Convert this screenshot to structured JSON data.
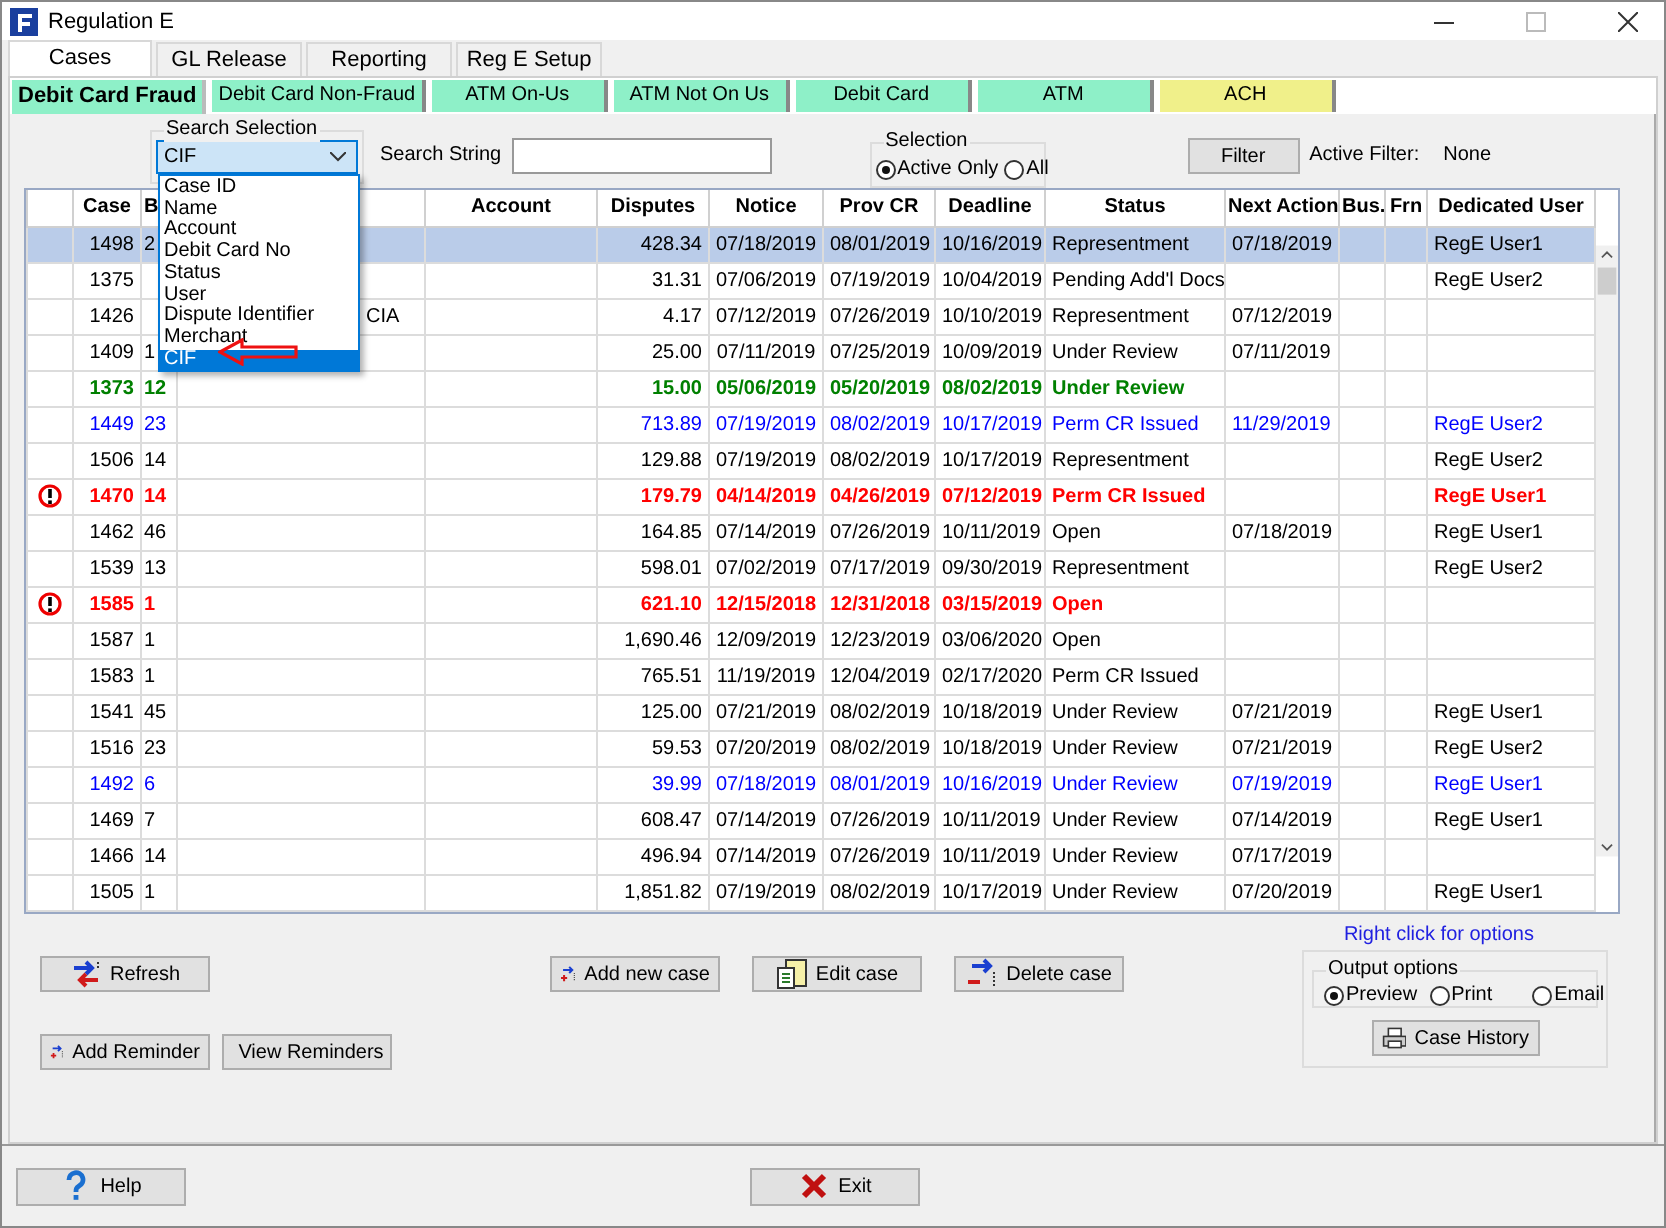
{
  "window": {
    "title": "Regulation E"
  },
  "tabs": [
    {
      "label": "Cases",
      "selected": true
    },
    {
      "label": "GL Release",
      "selected": false
    },
    {
      "label": "Reporting",
      "selected": false
    },
    {
      "label": "Reg E Setup",
      "selected": false
    }
  ],
  "subtabs": [
    {
      "label": "Debit Card Fraud",
      "selected": true,
      "color": "#8ef0c8"
    },
    {
      "label": "Debit Card Non-Fraud",
      "selected": false,
      "color": "#8ef0c8"
    },
    {
      "label": "ATM On-Us",
      "selected": false,
      "color": "#8ef0c8"
    },
    {
      "label": "ATM Not On Us",
      "selected": false,
      "color": "#8ef0c8"
    },
    {
      "label": "Debit Card",
      "selected": false,
      "color": "#8ef0c8"
    },
    {
      "label": "ATM",
      "selected": false,
      "color": "#8ef0c8"
    },
    {
      "label": "ACH",
      "selected": false,
      "color": "#f0f08a"
    }
  ],
  "search": {
    "group_label": "Search Selection",
    "value": "CIF",
    "expanded": true,
    "options": [
      {
        "label": "Case ID",
        "selected": false
      },
      {
        "label": "Name",
        "selected": false
      },
      {
        "label": "Account",
        "selected": false
      },
      {
        "label": "Debit Card No",
        "selected": false
      },
      {
        "label": "Status",
        "selected": false
      },
      {
        "label": "User",
        "selected": false
      },
      {
        "label": "Dispute Identifier",
        "selected": false
      },
      {
        "label": "Merchant",
        "selected": false
      },
      {
        "label": "CIF",
        "selected": true
      }
    ],
    "string_label": "Search String"
  },
  "selection": {
    "label": "Selection",
    "options": [
      {
        "label": "Active Only",
        "selected": true
      },
      {
        "label": "All",
        "selected": false
      }
    ]
  },
  "filter": {
    "button": "Filter",
    "active_label": "Active Filter:",
    "active_value": "None"
  },
  "table": {
    "columns": [
      "Case",
      "B",
      "Account",
      "Disputes",
      "Notice",
      "Prov CR",
      "Deadline",
      "Status",
      "Next Action",
      "Bus.",
      "Frn",
      "Dedicated User"
    ],
    "rows": [
      {
        "selected": true,
        "color": "#000000",
        "bold": false,
        "alert": false,
        "case": "1498",
        "b": "2",
        "disputes": "428.34",
        "notice": "07/18/2019",
        "prov_cr": "08/01/2019",
        "deadline": "10/16/2019",
        "status": "Representment",
        "next_action": "07/18/2019",
        "dedicated_user": "RegE User1"
      },
      {
        "selected": false,
        "color": "#000000",
        "bold": false,
        "alert": false,
        "case": "1375",
        "disputes": "31.31",
        "notice": "07/06/2019",
        "prov_cr": "07/19/2019",
        "deadline": "10/04/2019",
        "status": "Pending Add'l Docs",
        "dedicated_user": "RegE User2"
      },
      {
        "selected": false,
        "color": "#000000",
        "bold": false,
        "alert": false,
        "case": "1426",
        "column_3": "CIA",
        "disputes": "4.17",
        "notice": "07/12/2019",
        "prov_cr": "07/26/2019",
        "deadline": "10/10/2019",
        "status": "Representment",
        "next_action": "07/12/2019"
      },
      {
        "selected": false,
        "color": "#000000",
        "bold": false,
        "alert": false,
        "case": "1409",
        "b": "1",
        "disputes": "25.00",
        "notice": "07/11/2019",
        "prov_cr": "07/25/2019",
        "deadline": "10/09/2019",
        "status": "Under Review",
        "next_action": "07/11/2019"
      },
      {
        "selected": false,
        "color": "#008000",
        "bold": true,
        "alert": false,
        "case": "1373",
        "b": "12",
        "disputes": "15.00",
        "notice": "05/06/2019",
        "prov_cr": "05/20/2019",
        "deadline": "08/02/2019",
        "status": "Under Review"
      },
      {
        "selected": false,
        "color": "#0000ff",
        "bold": false,
        "alert": false,
        "case": "1449",
        "b": "23",
        "disputes": "713.89",
        "notice": "07/19/2019",
        "prov_cr": "08/02/2019",
        "deadline": "10/17/2019",
        "status": "Perm CR Issued",
        "next_action": "11/29/2019",
        "dedicated_user": "RegE User2"
      },
      {
        "selected": false,
        "color": "#000000",
        "bold": false,
        "alert": false,
        "case": "1506",
        "b": "14",
        "disputes": "129.88",
        "notice": "07/19/2019",
        "prov_cr": "08/02/2019",
        "deadline": "10/17/2019",
        "status": "Representment",
        "dedicated_user": "RegE User2"
      },
      {
        "selected": false,
        "color": "#ff0000",
        "bold": true,
        "alert": true,
        "case": "1470",
        "b": "14",
        "disputes": "179.79",
        "notice": "04/14/2019",
        "prov_cr": "04/26/2019",
        "deadline": "07/12/2019",
        "status": "Perm CR Issued",
        "dedicated_user": "RegE User1"
      },
      {
        "selected": false,
        "color": "#000000",
        "bold": false,
        "alert": false,
        "case": "1462",
        "b": "46",
        "disputes": "164.85",
        "notice": "07/14/2019",
        "prov_cr": "07/26/2019",
        "deadline": "10/11/2019",
        "status": "Open",
        "next_action": "07/18/2019",
        "dedicated_user": "RegE User1"
      },
      {
        "selected": false,
        "color": "#000000",
        "bold": false,
        "alert": false,
        "case": "1539",
        "b": "13",
        "disputes": "598.01",
        "notice": "07/02/2019",
        "prov_cr": "07/17/2019",
        "deadline": "09/30/2019",
        "status": "Representment",
        "dedicated_user": "RegE User2"
      },
      {
        "selected": false,
        "color": "#ff0000",
        "bold": true,
        "alert": true,
        "case": "1585",
        "b": "1",
        "disputes": "621.10",
        "notice": "12/15/2018",
        "prov_cr": "12/31/2018",
        "deadline": "03/15/2019",
        "status": "Open"
      },
      {
        "selected": false,
        "color": "#000000",
        "bold": false,
        "alert": false,
        "case": "1587",
        "b": "1",
        "disputes": "1,690.46",
        "notice": "12/09/2019",
        "prov_cr": "12/23/2019",
        "deadline": "03/06/2020",
        "status": "Open"
      },
      {
        "selected": false,
        "color": "#000000",
        "bold": false,
        "alert": false,
        "case": "1583",
        "b": "1",
        "disputes": "765.51",
        "notice": "11/19/2019",
        "prov_cr": "12/04/2019",
        "deadline": "02/17/2020",
        "status": "Perm CR Issued"
      },
      {
        "selected": false,
        "color": "#000000",
        "bold": false,
        "alert": false,
        "case": "1541",
        "b": "45",
        "disputes": "125.00",
        "notice": "07/21/2019",
        "prov_cr": "08/02/2019",
        "deadline": "10/18/2019",
        "status": "Under Review",
        "next_action": "07/21/2019",
        "dedicated_user": "RegE User1"
      },
      {
        "selected": false,
        "color": "#000000",
        "bold": false,
        "alert": false,
        "case": "1516",
        "b": "23",
        "disputes": "59.53",
        "notice": "07/20/2019",
        "prov_cr": "08/02/2019",
        "deadline": "10/18/2019",
        "status": "Under Review",
        "next_action": "07/21/2019",
        "dedicated_user": "RegE User2"
      },
      {
        "selected": false,
        "color": "#0000ff",
        "bold": false,
        "alert": false,
        "case": "1492",
        "b": "6",
        "disputes": "39.99",
        "notice": "07/18/2019",
        "prov_cr": "08/01/2019",
        "deadline": "10/16/2019",
        "status": "Under Review",
        "next_action": "07/19/2019",
        "dedicated_user": "RegE User1"
      },
      {
        "selected": false,
        "color": "#000000",
        "bold": false,
        "alert": false,
        "case": "1469",
        "b": "7",
        "disputes": "608.47",
        "notice": "07/14/2019",
        "prov_cr": "07/26/2019",
        "deadline": "10/11/2019",
        "status": "Under Review",
        "next_action": "07/14/2019",
        "dedicated_user": "RegE User1"
      },
      {
        "selected": false,
        "color": "#000000",
        "bold": false,
        "alert": false,
        "case": "1466",
        "b": "14",
        "disputes": "496.94",
        "notice": "07/14/2019",
        "prov_cr": "07/26/2019",
        "deadline": "10/11/2019",
        "status": "Under Review",
        "next_action": "07/17/2019"
      },
      {
        "selected": false,
        "color": "#000000",
        "bold": false,
        "alert": false,
        "case": "1505",
        "b": "1",
        "disputes": "1,851.82",
        "notice": "07/19/2019",
        "prov_cr": "08/02/2019",
        "deadline": "10/17/2019",
        "status": "Under Review",
        "next_action": "07/20/2019",
        "dedicated_user": "RegE User1"
      }
    ]
  },
  "options_link": "Right click for options",
  "buttons": [
    {
      "label": "Refresh",
      "kind": "refresh"
    },
    {
      "label": "Add new case",
      "kind": "add"
    },
    {
      "label": "Edit case",
      "kind": "edit"
    },
    {
      "label": "Delete case",
      "kind": "delete"
    },
    {
      "label": "Add Reminder",
      "kind": "add"
    },
    {
      "label": "View Reminders",
      "kind": "edit"
    }
  ],
  "output_options": {
    "label": "Output options",
    "options": [
      {
        "label": "Preview",
        "selected": true
      },
      {
        "label": "Print",
        "selected": false
      },
      {
        "label": "Email",
        "selected": false
      }
    ],
    "button": "Case History"
  },
  "footer_buttons": [
    {
      "label": "Help",
      "kind": "help"
    },
    {
      "label": "Exit",
      "kind": "exit"
    }
  ]
}
